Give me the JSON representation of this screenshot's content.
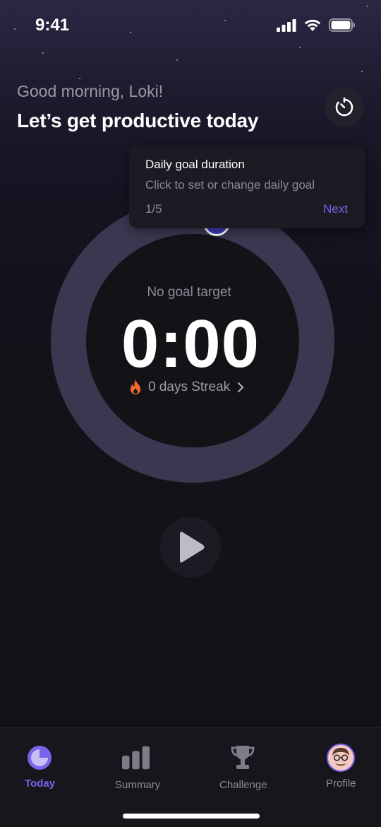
{
  "status_bar": {
    "time": "9:41"
  },
  "header": {
    "greeting": "Good morning, Loki!",
    "headline": "Let’s get productive today"
  },
  "timer": {
    "goal_label": "No goal target",
    "time": "0:00",
    "streak_text": "0 days Streak"
  },
  "tooltip": {
    "title": "Daily goal duration",
    "description": "Click to set or change daily goal",
    "step": "1/5",
    "next_label": "Next"
  },
  "tabs": [
    {
      "label": "Today",
      "icon": "pie-chart-icon",
      "active": true
    },
    {
      "label": "Summary",
      "icon": "bar-chart-icon",
      "active": false
    },
    {
      "label": "Challenge",
      "icon": "trophy-icon",
      "active": false
    },
    {
      "label": "Profile",
      "icon": "avatar",
      "active": false
    }
  ],
  "colors": {
    "accent": "#7b63ea",
    "ring": "#3a3850",
    "background": "#121218",
    "streak_flame": "#f06a2a"
  }
}
